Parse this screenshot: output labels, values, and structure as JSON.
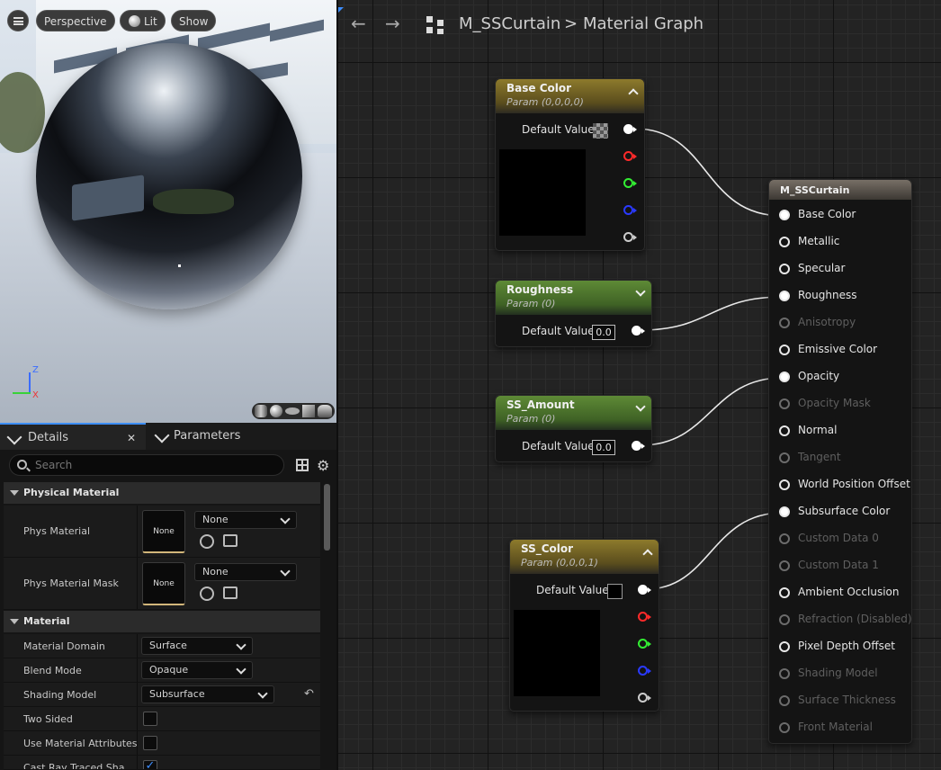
{
  "viewport": {
    "menu_icon": "hamburger-icon",
    "perspective": "Perspective",
    "lit": "Lit",
    "show": "Show",
    "axis_z": "Z",
    "axis_x": "X"
  },
  "panel": {
    "tab_details": "Details",
    "tab_parameters": "Parameters",
    "search_placeholder": "Search",
    "section_phys": "Physical Material",
    "phys_material": "Phys Material",
    "phys_material_mask": "Phys Material Mask",
    "none": "None",
    "none_thumb": "None",
    "section_material": "Material",
    "material_domain": "Material Domain",
    "material_domain_val": "Surface",
    "blend_mode": "Blend Mode",
    "blend_mode_val": "Opaque",
    "shading_model": "Shading Model",
    "shading_model_val": "Subsurface",
    "two_sided": "Two Sided",
    "use_mat_attr": "Use Material Attributes",
    "cast_ray": "Cast Ray Traced Sha"
  },
  "graph": {
    "asset": "M_SSCurtain",
    "separator": ">",
    "title": "Material Graph",
    "default_value": "Default Value",
    "nodes": [
      {
        "title": "Base Color",
        "sub": "Param (0,0,0,0)"
      },
      {
        "title": "Roughness",
        "sub": "Param (0)",
        "value": "0.0"
      },
      {
        "title": "SS_Amount",
        "sub": "Param (0)",
        "value": "0.0"
      },
      {
        "title": "SS_Color",
        "sub": "Param (0,0,0,1)"
      }
    ],
    "result_title": "M_SSCurtain",
    "result_pins": [
      "Base Color",
      "Metallic",
      "Specular",
      "Roughness",
      "Anisotropy",
      "Emissive Color",
      "Opacity",
      "Opacity Mask",
      "Normal",
      "Tangent",
      "World Position Offset",
      "Subsurface Color",
      "Custom Data 0",
      "Custom Data 1",
      "Ambient Occlusion",
      "Refraction (Disabled)",
      "Pixel Depth Offset",
      "Shading Model",
      "Surface Thickness",
      "Front Material"
    ],
    "pin_colors": {
      "red": "#ff2a2a",
      "green": "#33ee33",
      "blue": "#2a3aff",
      "white": "#ffffff"
    }
  }
}
